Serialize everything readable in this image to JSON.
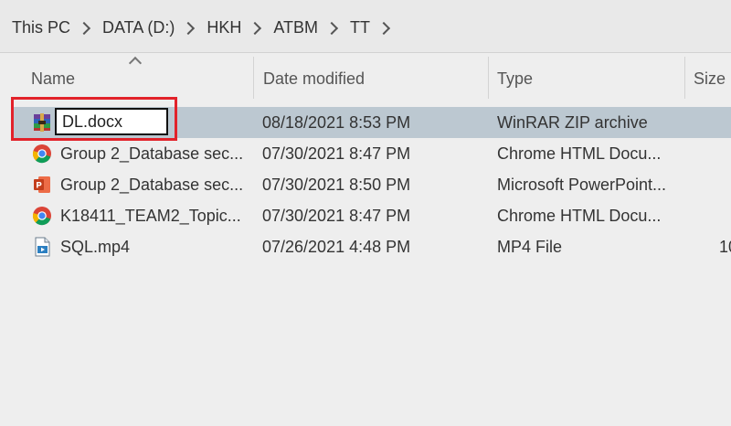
{
  "breadcrumb": [
    "This PC",
    "DATA (D:)",
    "HKH",
    "ATBM",
    "TT"
  ],
  "columns": {
    "name": "Name",
    "date": "Date modified",
    "type": "Type",
    "size": "Size"
  },
  "rename_value": "DL.docx",
  "files": [
    {
      "name": "",
      "date": "08/18/2021 8:53 PM",
      "type": "WinRAR ZIP archive",
      "size": "",
      "icon": "winrar-icon"
    },
    {
      "name": "Group 2_Database sec...",
      "date": "07/30/2021 8:47 PM",
      "type": "Chrome HTML Docu...",
      "size": "",
      "icon": "chrome-icon"
    },
    {
      "name": "Group 2_Database sec...",
      "date": "07/30/2021 8:50 PM",
      "type": "Microsoft PowerPoint...",
      "size": "",
      "icon": "powerpoint-icon"
    },
    {
      "name": "K18411_TEAM2_Topic...",
      "date": "07/30/2021 8:47 PM",
      "type": "Chrome HTML Docu...",
      "size": "",
      "icon": "chrome-icon"
    },
    {
      "name": "SQL.mp4",
      "date": "07/26/2021 4:48 PM",
      "type": "MP4 File",
      "size": "10",
      "icon": "video-file-icon"
    }
  ],
  "colors": {
    "selection": "#bcc8d1",
    "highlight": "#e2222a"
  }
}
